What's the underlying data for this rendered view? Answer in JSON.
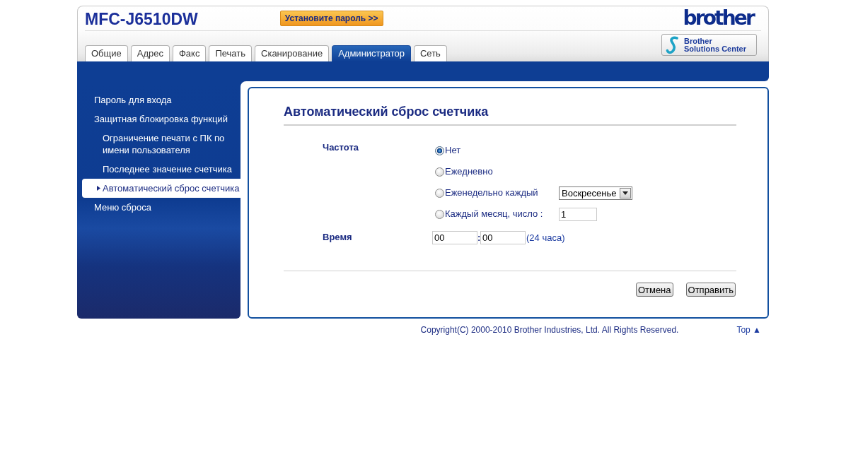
{
  "header": {
    "title": "MFC-J6510DW",
    "password_button": "Установите пароль >>",
    "logo": "brother",
    "solutions_button": "Brother Solutions Center"
  },
  "tabs": [
    {
      "label": "Общие",
      "selected": false
    },
    {
      "label": "Адрес",
      "selected": false
    },
    {
      "label": "Факс",
      "selected": false
    },
    {
      "label": "Печать",
      "selected": false
    },
    {
      "label": "Сканирование",
      "selected": false
    },
    {
      "label": "Администратор",
      "selected": true
    },
    {
      "label": "Сеть",
      "selected": false
    }
  ],
  "sidebar": {
    "items": [
      {
        "label": "Пароль для входа",
        "selected": false
      },
      {
        "label": "Защитная блокировка функций",
        "selected": false,
        "children": [
          {
            "label": "Ограничение печати с ПК по имени пользователя",
            "selected": false
          },
          {
            "label": "Последнее значение счетчика",
            "selected": false
          },
          {
            "label": "Автоматический сброс счетчика",
            "selected": true
          }
        ]
      },
      {
        "label": "Меню сброса",
        "selected": false
      }
    ]
  },
  "form": {
    "title": "Автоматический сброс счетчика",
    "fields": [
      {
        "kind": "radio_group",
        "label": "Частота",
        "options": [
          {
            "label": "Нет",
            "selected": true
          },
          {
            "label": "Ежедневно",
            "selected": false
          },
          {
            "label": "Еженедельно каждый",
            "selected": false,
            "control": {
              "kind": "select",
              "value": "Воскресенье"
            }
          },
          {
            "label": "Каждый месяц, число :",
            "selected": false,
            "control": {
              "kind": "input",
              "value": "1"
            }
          }
        ]
      },
      {
        "kind": "time",
        "label": "Время",
        "hour": "00",
        "separator": ":",
        "minute": "00",
        "note": "(24 часа)"
      }
    ],
    "buttons": [
      "Отмена",
      "Отправить"
    ]
  },
  "footer": {
    "copyright": "Copyright(C) 2000-2010 Brother Industries, Ltd. All Rights Reserved.",
    "top_link": "Top ▲"
  }
}
